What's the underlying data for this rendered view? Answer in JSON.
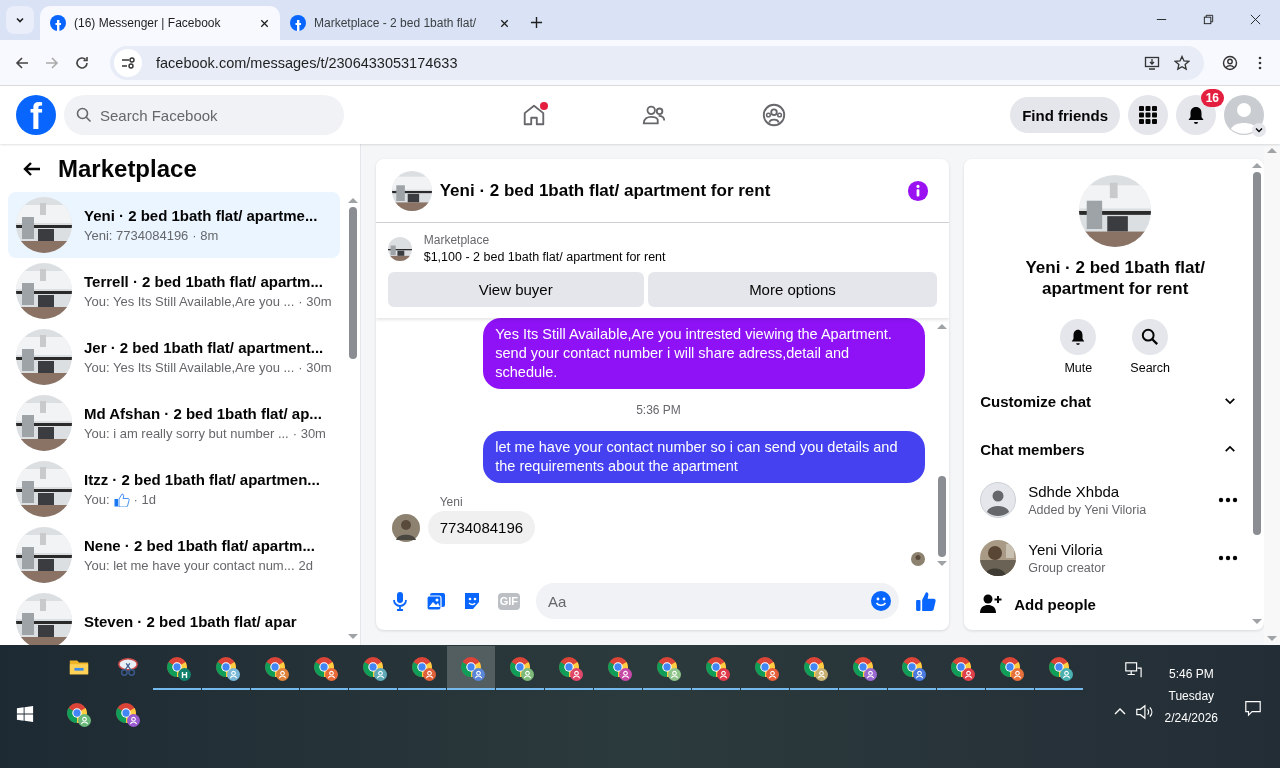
{
  "browser": {
    "tabs": [
      {
        "title": "(16) Messenger | Facebook",
        "selected": true
      },
      {
        "title": "Marketplace - 2 bed 1bath flat/",
        "selected": false
      }
    ],
    "url": "facebook.com/messages/t/2306433053174633"
  },
  "header": {
    "logo_letter": "f",
    "search_placeholder": "Search Facebook",
    "find_friends": "Find friends",
    "notifications_count": "16"
  },
  "sidebar": {
    "title": "Marketplace",
    "chats": [
      {
        "name": "Yeni · 2 bed 1bath flat/ apartme...",
        "preview": "Yeni: 7734084196",
        "like": false,
        "time": "· 8m",
        "selected": true
      },
      {
        "name": "Terrell · 2 bed 1bath flat/ apartm...",
        "preview": "You: Yes Its Still Available,Are you ...",
        "like": false,
        "time": "· 30m",
        "selected": false
      },
      {
        "name": "Jer · 2 bed 1bath flat/ apartment...",
        "preview": "You: Yes Its Still Available,Are you ...",
        "like": false,
        "time": "· 30m",
        "selected": false
      },
      {
        "name": "Md Afshan · 2 bed 1bath flat/ ap...",
        "preview": "You: i am really sorry but number ...",
        "like": false,
        "time": "· 30m",
        "selected": false
      },
      {
        "name": "Itzz · 2 bed 1bath flat/ apartmen...",
        "preview": "You:",
        "like": true,
        "time": "· 1d",
        "selected": false
      },
      {
        "name": "Nene · 2 bed 1bath flat/ apartm...",
        "preview": "You: let me have your contact num...",
        "like": false,
        "time": "2d",
        "selected": false
      },
      {
        "name": "Steven · 2 bed 1bath flat/ apar",
        "selected": false
      }
    ]
  },
  "conversation": {
    "title": "Yeni · 2 bed 1bath flat/ apartment for rent",
    "listing_label": "Marketplace",
    "listing_text": "$1,100 - 2 bed 1bath flat/ apartment for rent",
    "buttons": [
      "View buyer",
      "More options"
    ],
    "messages": [
      {
        "kind": "outgoing",
        "text": "Yes Its Still Available,Are you intrested viewing the Apartment. send your contact number i will share adress,detail and schedule.",
        "color": "#8f12f6"
      },
      {
        "kind": "time",
        "text": "5:36 PM"
      },
      {
        "kind": "outgoing",
        "text": "let me have your contact number so i can send you details and the requirements about the apartment",
        "color": "#4541f0"
      },
      {
        "kind": "incoming",
        "sender": "Yeni",
        "text": "7734084196"
      },
      {
        "kind": "seen"
      }
    ],
    "gif_label": "GIF",
    "composer_placeholder": "Aa"
  },
  "details": {
    "title": "Yeni · 2 bed 1bath flat/ apartment for rent",
    "actions": [
      "Mute",
      "Search"
    ],
    "sections": [
      {
        "label": "Customize chat",
        "expanded": false
      },
      {
        "label": "Chat members",
        "expanded": true
      }
    ],
    "members": [
      {
        "name": "Sdhde Xhbda",
        "role": "Added by Yeni Viloria",
        "kind": "default"
      },
      {
        "name": "Yeni Viloria",
        "role": "Group creator"
      }
    ],
    "add_people": "Add people"
  },
  "taskbar": {
    "apps": [
      {
        "kind": "folder",
        "selected": false
      },
      {
        "kind": "snip",
        "selected": false
      },
      {
        "kind": "chrome",
        "color": "#12806a",
        "letter": "H",
        "selected": false
      },
      {
        "kind": "chrome",
        "color": "#7ab8d9",
        "selected": false
      },
      {
        "kind": "chrome",
        "color": "#e0823a",
        "selected": false
      },
      {
        "kind": "chrome",
        "color": "#e86a3a",
        "selected": false
      },
      {
        "kind": "chrome",
        "color": "#5fa9b8",
        "selected": false
      },
      {
        "kind": "chrome",
        "color": "#e0603a",
        "selected": false
      },
      {
        "kind": "chrome",
        "color": "#5a86d8",
        "selected": true
      },
      {
        "kind": "chrome",
        "color": "#7dbb7a",
        "selected": false
      },
      {
        "kind": "chrome",
        "color": "#e0486a",
        "selected": false
      },
      {
        "kind": "chrome",
        "color": "#c84aa8",
        "selected": false
      },
      {
        "kind": "chrome",
        "color": "#8fc48a",
        "selected": false
      },
      {
        "kind": "chrome",
        "color": "#e03a4a",
        "selected": false
      },
      {
        "kind": "chrome",
        "color": "#e8603a",
        "selected": false
      },
      {
        "kind": "chrome",
        "color": "#c8b070",
        "selected": false
      },
      {
        "kind": "chrome",
        "color": "#9a6ad0",
        "selected": false
      },
      {
        "kind": "chrome",
        "color": "#4a7ae0",
        "selected": false
      },
      {
        "kind": "chrome",
        "color": "#e0404a",
        "selected": false
      },
      {
        "kind": "chrome",
        "color": "#e8703a",
        "selected": false
      },
      {
        "kind": "chrome",
        "color": "#4ab0b0",
        "selected": false
      }
    ],
    "second_row": [
      {
        "kind": "chrome",
        "color": "#6ab87a",
        "selected": false
      },
      {
        "kind": "chrome",
        "color": "#9a5ad0",
        "selected": false
      }
    ],
    "time": "5:46 PM",
    "day": "Tuesday",
    "date": "2/24/2026"
  }
}
